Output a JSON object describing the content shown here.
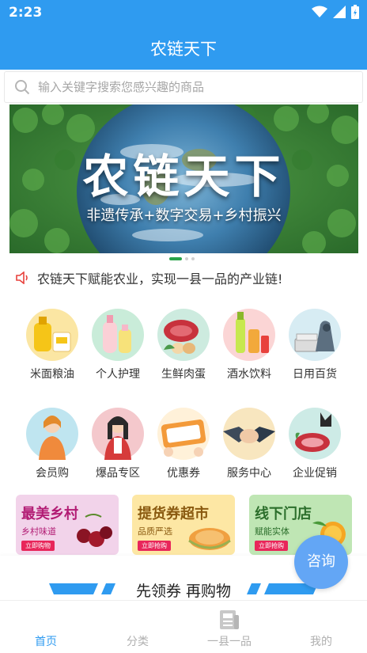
{
  "status_bar": {
    "time": "2:23"
  },
  "app": {
    "title": "农链天下"
  },
  "search": {
    "placeholder": "输入关键字搜索您感兴趣的商品"
  },
  "banner": {
    "title": "农链天下",
    "subtitle": "非遗传承+数字交易+乡村振兴",
    "page_count": 3,
    "active_page": 1
  },
  "notice": {
    "text": "农链天下赋能农业，实现一县一品的产业链!"
  },
  "categories": [
    {
      "label": "米面粮油",
      "icon": "oil-rice-icon"
    },
    {
      "label": "个人护理",
      "icon": "personal-care-icon"
    },
    {
      "label": "生鲜肉蛋",
      "icon": "fresh-meat-icon"
    },
    {
      "label": "酒水饮料",
      "icon": "drinks-icon"
    },
    {
      "label": "日用百货",
      "icon": "household-icon"
    },
    {
      "label": "会员购",
      "icon": "member-icon"
    },
    {
      "label": "爆品专区",
      "icon": "hot-products-icon"
    },
    {
      "label": "优惠券",
      "icon": "coupon-icon"
    },
    {
      "label": "服务中心",
      "icon": "handshake-icon"
    },
    {
      "label": "企业促销",
      "icon": "promotion-icon"
    }
  ],
  "promos": [
    {
      "title": "最美乡村",
      "subtitle": "乡村味道",
      "button": "立即购物",
      "bg": "#f2d3ea",
      "color": "#b21c74"
    },
    {
      "title": "提货券超市",
      "subtitle": "品质严选",
      "button": "立即抢购",
      "bg": "#fde7a4",
      "color": "#8a5a10"
    },
    {
      "title": "线下门店",
      "subtitle": "赋能实体",
      "button": "立即抢购",
      "bg": "#bfe6b4",
      "color": "#2b6e2b"
    }
  ],
  "consult": {
    "label": "咨询"
  },
  "coupon_strip": {
    "text": "先领券 再购物"
  },
  "bottom_nav": [
    {
      "label": "首页",
      "active": true
    },
    {
      "label": "分类",
      "active": false
    },
    {
      "label": "一县一品",
      "active": false
    },
    {
      "label": "我的",
      "active": false
    }
  ],
  "colors": {
    "primary": "#2f9bf0",
    "accent_green": "#2aa34a",
    "badge_red": "#e8265a"
  }
}
